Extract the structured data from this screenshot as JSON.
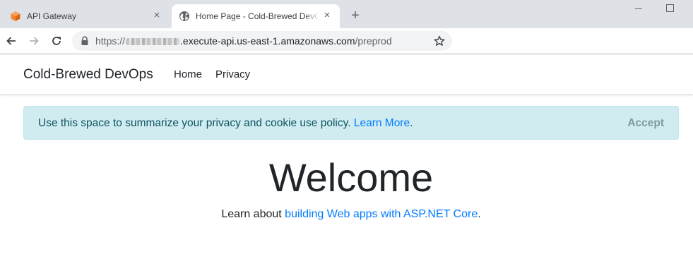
{
  "browser": {
    "tabs": [
      {
        "title": "API Gateway",
        "icon": "aws-cube-icon"
      },
      {
        "title": "Home Page - Cold-Brewed DevOps",
        "icon": "globe-icon"
      }
    ],
    "new_tab_symbol": "+",
    "close_symbol": "×",
    "url": {
      "scheme": "https://",
      "host": ".execute-api.us-east-1.amazonaws.com",
      "path": "/preprod"
    }
  },
  "site": {
    "brand": "Cold-Brewed DevOps",
    "nav": [
      {
        "label": "Home"
      },
      {
        "label": "Privacy"
      }
    ]
  },
  "cookie_alert": {
    "message": "Use this space to summarize your privacy and cookie use policy.",
    "link": "Learn More",
    "period": ".",
    "accept": "Accept"
  },
  "main": {
    "heading": "Welcome",
    "learn_prefix": "Learn about",
    "learn_link": "building Web apps with ASP.NET Core",
    "learn_suffix": "."
  },
  "colors": {
    "tab_strip": "#dee1e6",
    "link": "#007bff",
    "alert_bg": "#d1ecf1",
    "alert_text": "#0c5460",
    "aws_orange": "#f58536"
  }
}
